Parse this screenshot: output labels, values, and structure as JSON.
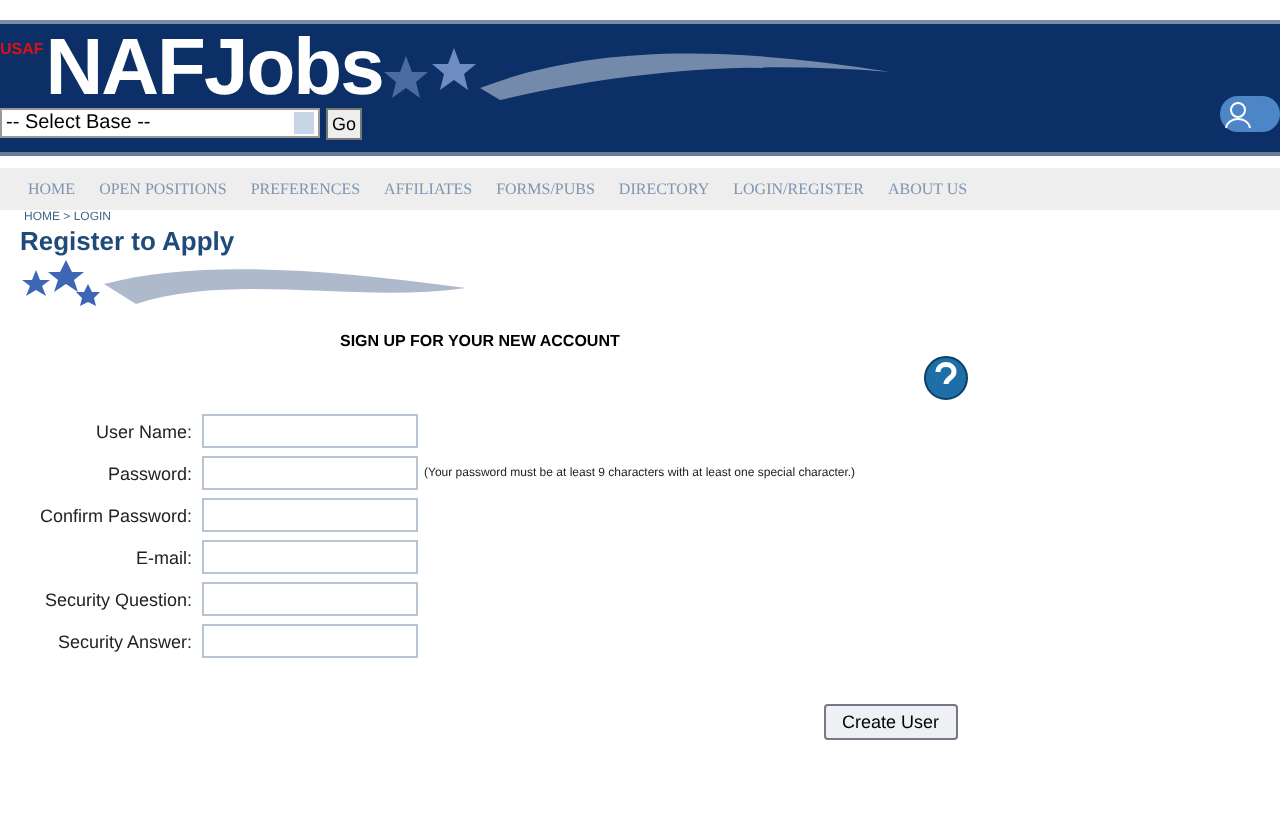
{
  "header": {
    "logo_badge": "USAF",
    "logo": "NAFJobs",
    "base_select": {
      "value": "-- Select Base --"
    },
    "go_button": "Go"
  },
  "nav": [
    {
      "label": "HOME"
    },
    {
      "label": "OPEN POSITIONS"
    },
    {
      "label": "PREFERENCES"
    },
    {
      "label": "AFFILIATES"
    },
    {
      "label": "FORMS/PUBS"
    },
    {
      "label": "DIRECTORY"
    },
    {
      "label": "LOGIN/REGISTER"
    },
    {
      "label": "ABOUT US"
    }
  ],
  "breadcrumb": "HOME > LOGIN",
  "page_title": "Register to Apply",
  "form": {
    "heading": "SIGN UP FOR YOUR NEW ACCOUNT",
    "fields": [
      {
        "label": "User Name:"
      },
      {
        "label": "Password:",
        "note": "(Your password must be at least 9 characters with at least one special character.)"
      },
      {
        "label": "Confirm Password:"
      },
      {
        "label": "E-mail:"
      },
      {
        "label": "Security Question:"
      },
      {
        "label": "Security Answer:"
      }
    ],
    "submit": "Create User"
  }
}
